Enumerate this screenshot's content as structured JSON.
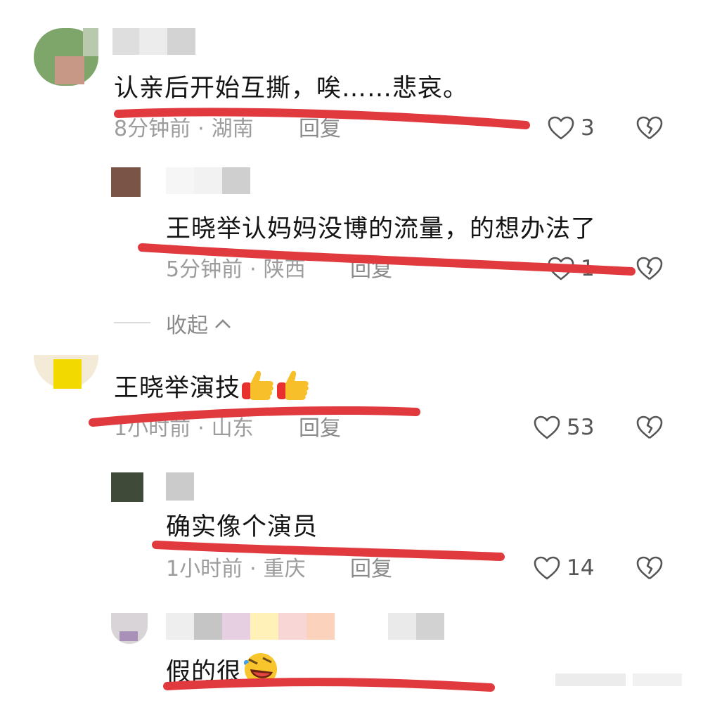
{
  "comments": [
    {
      "text": "认亲后开始互撕，唉……悲哀。",
      "time": "8分钟前",
      "location": "湖南",
      "reply_label": "回复",
      "likes": "3"
    },
    {
      "text": "王晓举认妈妈没博的流量，的想办法了",
      "time": "5分钟前",
      "location": "陕西",
      "reply_label": "回复",
      "likes": "1"
    },
    {
      "text": "王晓举演技",
      "time": "1小时前",
      "location": "山东",
      "reply_label": "回复",
      "likes": "53"
    },
    {
      "text": "确实像个演员",
      "time": "1小时前",
      "location": "重庆",
      "reply_label": "回复",
      "likes": "14"
    },
    {
      "text": "假的很"
    }
  ],
  "collapse_label": "收起",
  "icons": {
    "like": "heart-outline-icon",
    "dislike": "broken-heart-icon",
    "collapse": "chevron-up-icon",
    "thumbs": "thumbs-up-emoji",
    "laugh": "rolling-laughing-emoji"
  },
  "colors": {
    "underline": "#e0393e",
    "meta": "#9c9c9c",
    "text": "#141414"
  }
}
